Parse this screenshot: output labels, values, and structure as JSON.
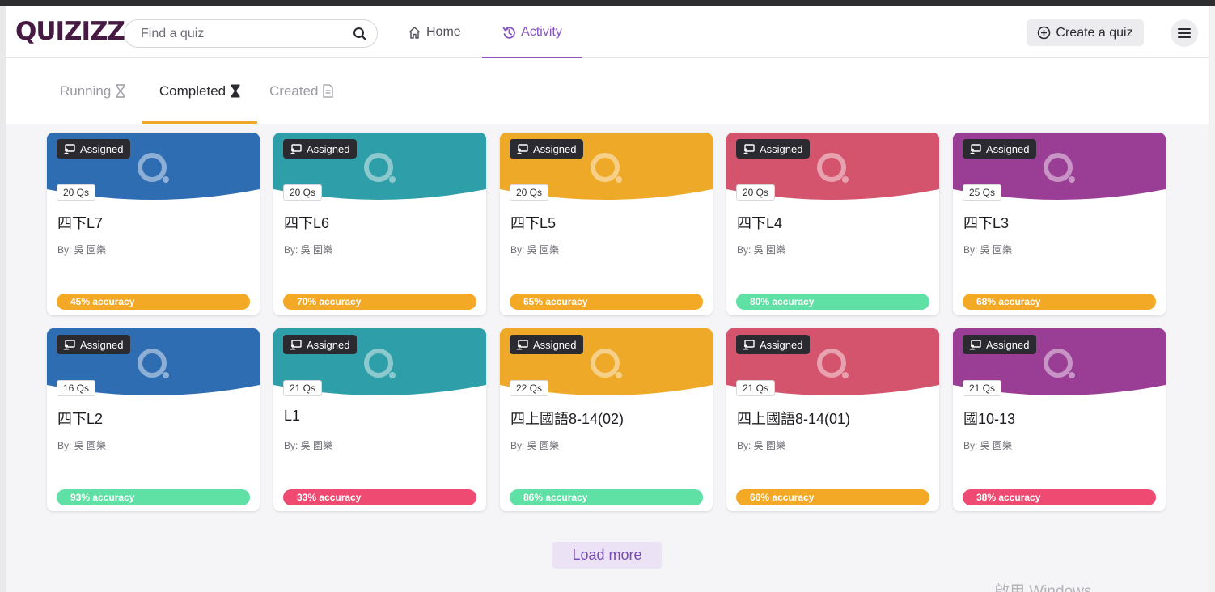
{
  "header": {
    "logo": "QUIZIZZ",
    "search_placeholder": "Find a quiz",
    "nav": [
      {
        "label": "Home",
        "icon": "home-icon"
      },
      {
        "label": "Activity",
        "icon": "history-icon",
        "active": true
      }
    ],
    "create_label": "Create a quiz",
    "menu_icon": "hamburger-icon"
  },
  "subtabs": [
    {
      "label": "Running",
      "icon": "hourglass-outline-icon"
    },
    {
      "label": "Completed",
      "icon": "hourglass-filled-icon",
      "active": true
    },
    {
      "label": "Created",
      "icon": "document-icon"
    }
  ],
  "colors": {
    "blue": "#2f6db3",
    "teal": "#2e9ea8",
    "orange": "#efa929",
    "red": "#d4546d",
    "purple": "#993d95",
    "acc_orange": "#f4a926",
    "acc_green": "#5fe0a4",
    "acc_red": "#ef4b72",
    "accent": "#8854c0"
  },
  "cards": [
    {
      "badge": "Assigned",
      "questions": "20 Qs",
      "title": "四下L7",
      "author": "By: 吳 園樂",
      "accuracy": "45% accuracy",
      "theme": "blue",
      "acc_color": "acc_orange"
    },
    {
      "badge": "Assigned",
      "questions": "20 Qs",
      "title": "四下L6",
      "author": "By: 吳 園樂",
      "accuracy": "70% accuracy",
      "theme": "teal",
      "acc_color": "acc_orange"
    },
    {
      "badge": "Assigned",
      "questions": "20 Qs",
      "title": "四下L5",
      "author": "By: 吳 園樂",
      "accuracy": "65% accuracy",
      "theme": "orange",
      "acc_color": "acc_orange"
    },
    {
      "badge": "Assigned",
      "questions": "20 Qs",
      "title": "四下L4",
      "author": "By: 吳 園樂",
      "accuracy": "80% accuracy",
      "theme": "red",
      "acc_color": "acc_green"
    },
    {
      "badge": "Assigned",
      "questions": "25 Qs",
      "title": "四下L3",
      "author": "By: 吳 園樂",
      "accuracy": "68% accuracy",
      "theme": "purple",
      "acc_color": "acc_orange"
    },
    {
      "badge": "Assigned",
      "questions": "16 Qs",
      "title": "四下L2",
      "author": "By: 吳 園樂",
      "accuracy": "93% accuracy",
      "theme": "blue",
      "acc_color": "acc_green"
    },
    {
      "badge": "Assigned",
      "questions": "21 Qs",
      "title": "L1",
      "author": "By: 吳 園樂",
      "accuracy": "33% accuracy",
      "theme": "teal",
      "acc_color": "acc_red"
    },
    {
      "badge": "Assigned",
      "questions": "22 Qs",
      "title": "四上國語8-14(02)",
      "author": "By: 吳 園樂",
      "accuracy": "86% accuracy",
      "theme": "orange",
      "acc_color": "acc_green"
    },
    {
      "badge": "Assigned",
      "questions": "21 Qs",
      "title": "四上國語8-14(01)",
      "author": "By: 吳 園樂",
      "accuracy": "66% accuracy",
      "theme": "red",
      "acc_color": "acc_orange"
    },
    {
      "badge": "Assigned",
      "questions": "21 Qs",
      "title": "國10-13",
      "author": "By: 吳 園樂",
      "accuracy": "38% accuracy",
      "theme": "purple",
      "acc_color": "acc_red"
    }
  ],
  "load_more_label": "Load more",
  "watermark": "啟用 Windows"
}
